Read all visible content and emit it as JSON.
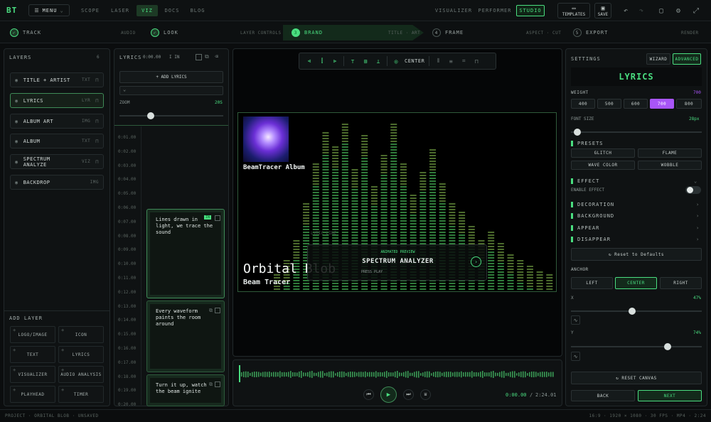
{
  "app": {
    "logo": "BT",
    "menu_label": "MENU"
  },
  "nav": {
    "tabs": [
      "SCOPE",
      "LASER",
      "VIZ",
      "DOCS",
      "BLOG"
    ],
    "active": "VIZ",
    "right_tabs": [
      "VISUALIZER",
      "PERFORMER",
      "STUDIO"
    ],
    "active_right": "STUDIO",
    "templates_label": "TEMPLATES",
    "save_label": "SAVE"
  },
  "steps": [
    {
      "num": "✓",
      "label": "TRACK",
      "sub": "AUDIO"
    },
    {
      "num": "✓",
      "label": "LOOK",
      "sub": "LAYER CONTROLS"
    },
    {
      "num": "3",
      "label": "BRAND",
      "sub": "TITLE · ART"
    },
    {
      "num": "4",
      "label": "FRAME",
      "sub": "ASPECT · CUT"
    },
    {
      "num": "5",
      "label": "EXPORT",
      "sub": "RENDER"
    }
  ],
  "layers": {
    "title": "LAYERS",
    "count": "6",
    "items": [
      {
        "label": "TITLE + ARTIST",
        "tag": "TXT"
      },
      {
        "label": "LYRICS",
        "tag": "LYR"
      },
      {
        "label": "ALBUM ART",
        "tag": "IMG"
      },
      {
        "label": "ALBUM",
        "tag": "TXT"
      },
      {
        "label": "SPECTRUM ANALYZE",
        "tag": "VIZ"
      },
      {
        "label": "BACKDROP",
        "tag": "IMG"
      }
    ],
    "add_title": "ADD LAYER",
    "add_items": [
      "LOGO/IMAGE",
      "ICON",
      "TEXT",
      "LYRICS",
      "VISUALIZER",
      "AUDIO ANALYSIS",
      "PLAYHEAD",
      "TIMER"
    ]
  },
  "lyrics": {
    "title": "LYRICS",
    "time": "0:00.00",
    "in_label": "I IN",
    "add_label": "+ ADD LYRICS",
    "zoom_label": "ZOOM",
    "zoom_value": "20S",
    "ticks": [
      "0:01.00",
      "0:02.00",
      "0:03.00",
      "0:04.00",
      "0:05.00",
      "0:06.00",
      "0:07.00",
      "0:08.00",
      "0:09.00",
      "0:10.00",
      "0:11.00",
      "0:12.00",
      "0:13.00",
      "0:14.00",
      "0:15.00",
      "0:16.00",
      "0:17.00",
      "0:18.00",
      "0:19.00",
      "0:20.00"
    ],
    "cards": [
      {
        "text": "Lines drawn in light, we trace the sound",
        "badge": "IN"
      },
      {
        "text": "Every waveform paints the room around",
        "badge": ""
      },
      {
        "text": "Turn it up, watch the beam ignite",
        "badge": ""
      }
    ]
  },
  "canvas": {
    "toolbar_center": "CENTER",
    "album_caption": "BeamTracer Album",
    "title": "Orbital Blob",
    "artist": "Beam Tracer",
    "preview_small": "ANIMATED PREVIEW",
    "preview_title": "SPECTRUM ANALYZER",
    "preview_sub": "PRESS PLAY",
    "lyric_ghost": "LYRIC LINE"
  },
  "transport": {
    "time": "0:00.00",
    "duration": "2:24.01"
  },
  "settings": {
    "title": "SETTINGS",
    "wizard": "WIZARD",
    "advanced": "ADVANCED",
    "heading": "LYRICS",
    "weight_label": "WEIGHT",
    "weight_value": "700",
    "weights": [
      "400",
      "500",
      "600",
      "700",
      "800"
    ],
    "weight_active": "700",
    "font_size_label": "FONT SIZE",
    "font_size_value": "28px",
    "font_size_level": 0.05,
    "presets_label": "PRESETS",
    "presets": [
      "GLITCH",
      "FLAME",
      "WAVE COLOR",
      "WOBBLE"
    ],
    "effect_label": "EFFECT",
    "enable_effect": "ENABLE EFFECT",
    "sections": [
      "DECORATION",
      "BACKGROUND",
      "APPEAR",
      "DISAPPEAR"
    ],
    "reset_defaults": "Reset to Defaults",
    "anchor_label": "ANCHOR",
    "anchors": [
      "LEFT",
      "CENTER",
      "RIGHT"
    ],
    "anchor_active": "CENTER",
    "x_label": "X",
    "x_value": "47%",
    "x_level": 0.47,
    "y_label": "Y",
    "y_value": "74%",
    "y_level": 0.74,
    "reset_canvas": "RESET CANVAS",
    "back": "BACK",
    "next": "NEXT"
  },
  "footer": {
    "left": "PROJECT · ORBITAL BLOB · UNSAVED",
    "right": "16:9 · 1920 × 1080 · 30 FPS · MP4 · 2:24"
  },
  "colors": {
    "accent": "#4ade80",
    "weight_active": "#a855f7"
  }
}
